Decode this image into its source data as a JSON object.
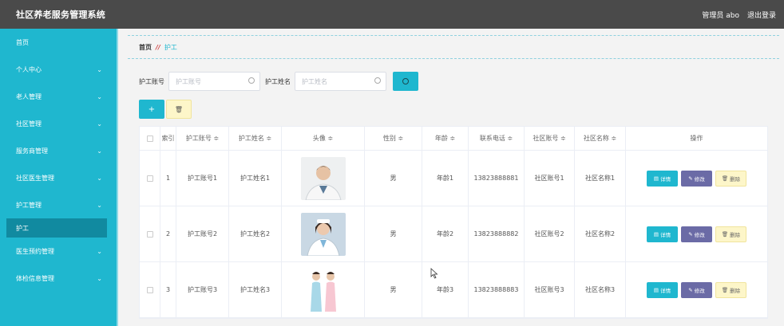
{
  "header": {
    "title": "社区养老服务管理系统",
    "user": "管理员 abo",
    "logout": "退出登录"
  },
  "sidebar": {
    "items": [
      {
        "label": "首页",
        "chevron": false
      },
      {
        "label": "个人中心",
        "chevron": true
      },
      {
        "label": "老人管理",
        "chevron": true
      },
      {
        "label": "社区管理",
        "chevron": true
      },
      {
        "label": "服务商管理",
        "chevron": true
      },
      {
        "label": "社区医生管理",
        "chevron": true
      },
      {
        "label": "护工管理",
        "chevron": true
      }
    ],
    "active_sub": "护工",
    "after": [
      {
        "label": "医生预约管理",
        "chevron": true
      },
      {
        "label": "体检信息管理",
        "chevron": true
      }
    ]
  },
  "breadcrumb": {
    "home": "首页",
    "sep": "//",
    "current": "护工"
  },
  "search": {
    "account_label": "护工账号",
    "account_placeholder": "护工账号",
    "name_label": "护工姓名",
    "name_placeholder": "护工姓名"
  },
  "toolbar": {
    "add": "+",
    "delete_icon": "trash-icon"
  },
  "table": {
    "headers": [
      "",
      "索引",
      "护工账号 ≑",
      "护工姓名 ≑",
      "头像 ≑",
      "性别 ≑",
      "年龄 ≑",
      "联系电话 ≑",
      "社区账号 ≑",
      "社区名称 ≑",
      "操作"
    ],
    "rows": [
      {
        "index": "1",
        "account": "护工账号1",
        "name": "护工姓名1",
        "gender": "男",
        "age": "年龄1",
        "phone": "13823888881",
        "community_account": "社区账号1",
        "community_name": "社区名称1"
      },
      {
        "index": "2",
        "account": "护工账号2",
        "name": "护工姓名2",
        "gender": "男",
        "age": "年龄2",
        "phone": "13823888882",
        "community_account": "社区账号2",
        "community_name": "社区名称2"
      },
      {
        "index": "3",
        "account": "护工账号3",
        "name": "护工姓名3",
        "gender": "男",
        "age": "年龄3",
        "phone": "13823888883",
        "community_account": "社区账号3",
        "community_name": "社区名称3"
      }
    ],
    "ops": {
      "detail": "详情",
      "edit": "修改",
      "delete": "删除"
    }
  },
  "colors": {
    "accent": "#1fb7cf",
    "topbar": "#4a4a4a",
    "edit": "#6b6ba6",
    "warn_bg": "#fdf6c9"
  }
}
